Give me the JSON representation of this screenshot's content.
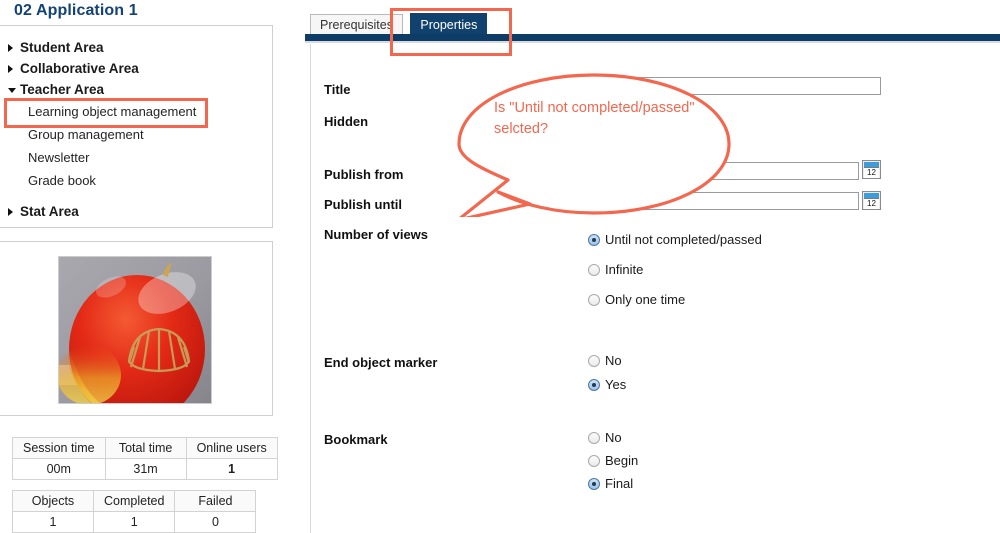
{
  "page": {
    "title": "02 Application 1"
  },
  "sidebar": {
    "nav": [
      {
        "label": "Student Area",
        "type": "top",
        "state": "collapsed"
      },
      {
        "label": "Collaborative Area",
        "type": "top",
        "state": "collapsed"
      },
      {
        "label": "Teacher Area",
        "type": "top",
        "state": "expanded"
      },
      {
        "label": "Learning object management",
        "type": "sub"
      },
      {
        "label": "Group management",
        "type": "sub"
      },
      {
        "label": "Newsletter",
        "type": "sub"
      },
      {
        "label": "Grade book",
        "type": "sub"
      },
      {
        "label": "Stat Area",
        "type": "top",
        "state": "collapsed"
      }
    ],
    "media": {
      "alt": "apple-with-shell-logo-image"
    },
    "stats": {
      "table1": {
        "headers": [
          "Session time",
          "Total time",
          "Online users"
        ],
        "rows": [
          [
            "00m",
            "31m",
            "1"
          ]
        ]
      },
      "table2": {
        "headers": [
          "Objects",
          "Completed",
          "Failed"
        ],
        "rows": [
          [
            "1",
            "1",
            "0"
          ]
        ]
      }
    }
  },
  "content": {
    "tabs": [
      {
        "label": "Prerequisites",
        "active": false
      },
      {
        "label": "Properties",
        "active": true
      }
    ],
    "form": {
      "labels": {
        "title": "Title",
        "hidden": "Hidden",
        "publish_from": "Publish from",
        "publish_until": "Publish until",
        "number_of_views": "Number of views",
        "end_object_marker": "End object marker",
        "bookmark": "Bookmark"
      },
      "fields": {
        "title_value": "",
        "publish_from_value": "",
        "publish_until_value": "",
        "calendar_icon_label": "12"
      },
      "number_of_views_options": [
        {
          "label": "Until not completed/passed",
          "selected": true
        },
        {
          "label": "Infinite",
          "selected": false
        },
        {
          "label": "Only one time",
          "selected": false
        }
      ],
      "end_object_marker_options": [
        {
          "label": "No",
          "selected": false
        },
        {
          "label": "Yes",
          "selected": true
        }
      ],
      "bookmark_options": [
        {
          "label": "No",
          "selected": false
        },
        {
          "label": "Begin",
          "selected": false
        },
        {
          "label": "Final",
          "selected": true
        }
      ]
    }
  },
  "annotations": {
    "color": "#f4674f",
    "callout_text": "Is \"Until not completed/passed\" selcted?",
    "highlight_nav_item": "Learning object management",
    "highlight_tab": "Properties"
  }
}
